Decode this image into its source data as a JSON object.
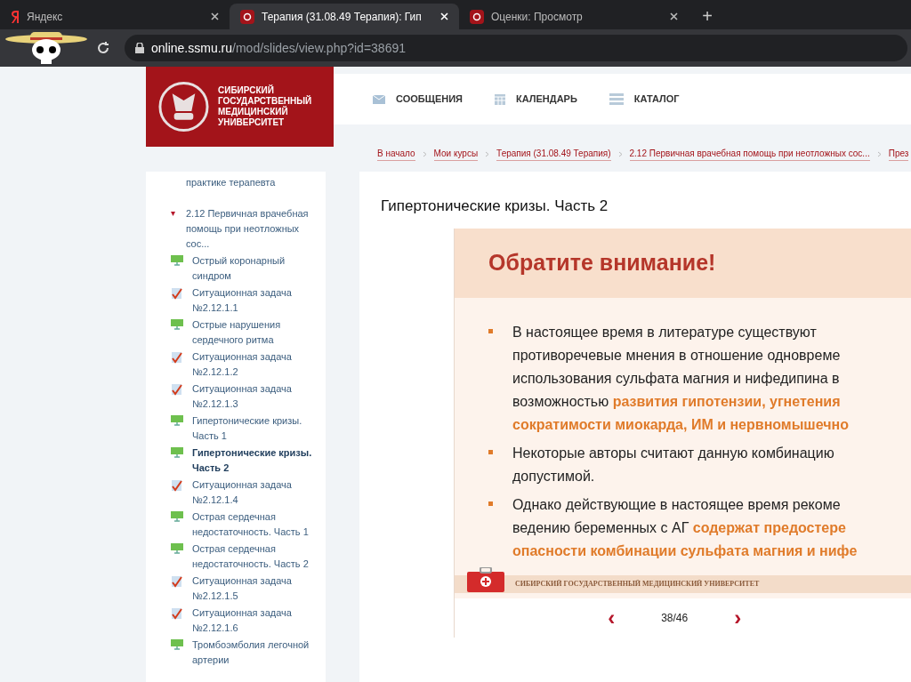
{
  "browser": {
    "tabs": [
      {
        "title": "Яндекс",
        "kind": "yandex",
        "selected": false
      },
      {
        "title": "Терапия (31.08.49 Терапия): Гип",
        "kind": "university",
        "selected": true
      },
      {
        "title": "Оценки: Просмотр",
        "kind": "university",
        "selected": false
      }
    ],
    "new_tab": "+",
    "url_host": "online.ssmu.ru",
    "url_path": "/mod/slides/view.php?id=38691"
  },
  "header": {
    "logo_text": "СИБИРСКИЙ ГОСУДАРСТВЕННЫЙ МЕДИЦИНСКИЙ УНИВЕРСИТЕТ",
    "nav": [
      {
        "label": "СООБЩЕНИЯ",
        "kind": "mail"
      },
      {
        "label": "КАЛЕНДАРЬ",
        "kind": "calendar"
      },
      {
        "label": "КАТАЛОГ",
        "kind": "catalog"
      }
    ]
  },
  "breadcrumb": [
    "В начало",
    "Мои курсы",
    "Терапия (31.08.49 Терапия)",
    "2.12 Первичная врачебная помощь при неотложных сос...",
    "През"
  ],
  "sidebar": {
    "top_text": "практике терапевта",
    "section": {
      "label": "2.12 Первичная врачебная помощь при неотложных сос...",
      "expanded": true,
      "children": [
        {
          "label": "Острый коронарный синдром",
          "kind": "page",
          "selected": false
        },
        {
          "label": "Ситуационная задача №2.12.1.1",
          "kind": "task",
          "selected": false
        },
        {
          "label": "Острые нарушения сердечного ритма",
          "kind": "page",
          "selected": false
        },
        {
          "label": "Ситуационная задача №2.12.1.2",
          "kind": "task",
          "selected": false
        },
        {
          "label": "Ситуационная задача №2.12.1.3",
          "kind": "task",
          "selected": false
        },
        {
          "label": "Гипертонические кризы. Часть 1",
          "kind": "page",
          "selected": false
        },
        {
          "label": "Гипертонические кризы. Часть 2",
          "kind": "page",
          "selected": true
        },
        {
          "label": "Ситуационная задача №2.12.1.4",
          "kind": "task",
          "selected": false
        },
        {
          "label": "Острая сердечная недостаточность. Часть 1",
          "kind": "page",
          "selected": false
        },
        {
          "label": "Острая сердечная недостаточность. Часть 2",
          "kind": "page",
          "selected": false
        },
        {
          "label": "Ситуационная задача №2.12.1.5",
          "kind": "task",
          "selected": false
        },
        {
          "label": "Ситуационная задача №2.12.1.6",
          "kind": "task",
          "selected": false
        },
        {
          "label": "Тромбоэмболия легочной артерии",
          "kind": "page",
          "selected": false
        }
      ]
    }
  },
  "main": {
    "title": "Гипертонические кризы. Часть 2",
    "slide": {
      "heading": "Обратите внимание!",
      "bullets": [
        [
          "В настоящее время в литературе существуют",
          "противоречевые мнения в отношение одновреме",
          "использования сульфата магния и нифедипина в",
          "возможностью **развития гипотензии, угнетения**",
          "**сократимости миокарда, ИМ и нервномышечно**"
        ],
        [
          "Некоторые авторы считают данную комбинацию",
          "допустимой."
        ],
        [
          "Однако действующие в настоящее время рекоме",
          "ведению беременных с АГ **содержат предостере**",
          "**опасности комбинации сульфата магния и нифе**"
        ]
      ],
      "footer": "СИБИРСКИЙ ГОСУДАРСТВЕННЫЙ МЕДИЦИНСКИЙ УНИВЕРСИТЕТ"
    },
    "pager": {
      "prev": "‹",
      "counter": "38/46",
      "next": "›"
    }
  }
}
